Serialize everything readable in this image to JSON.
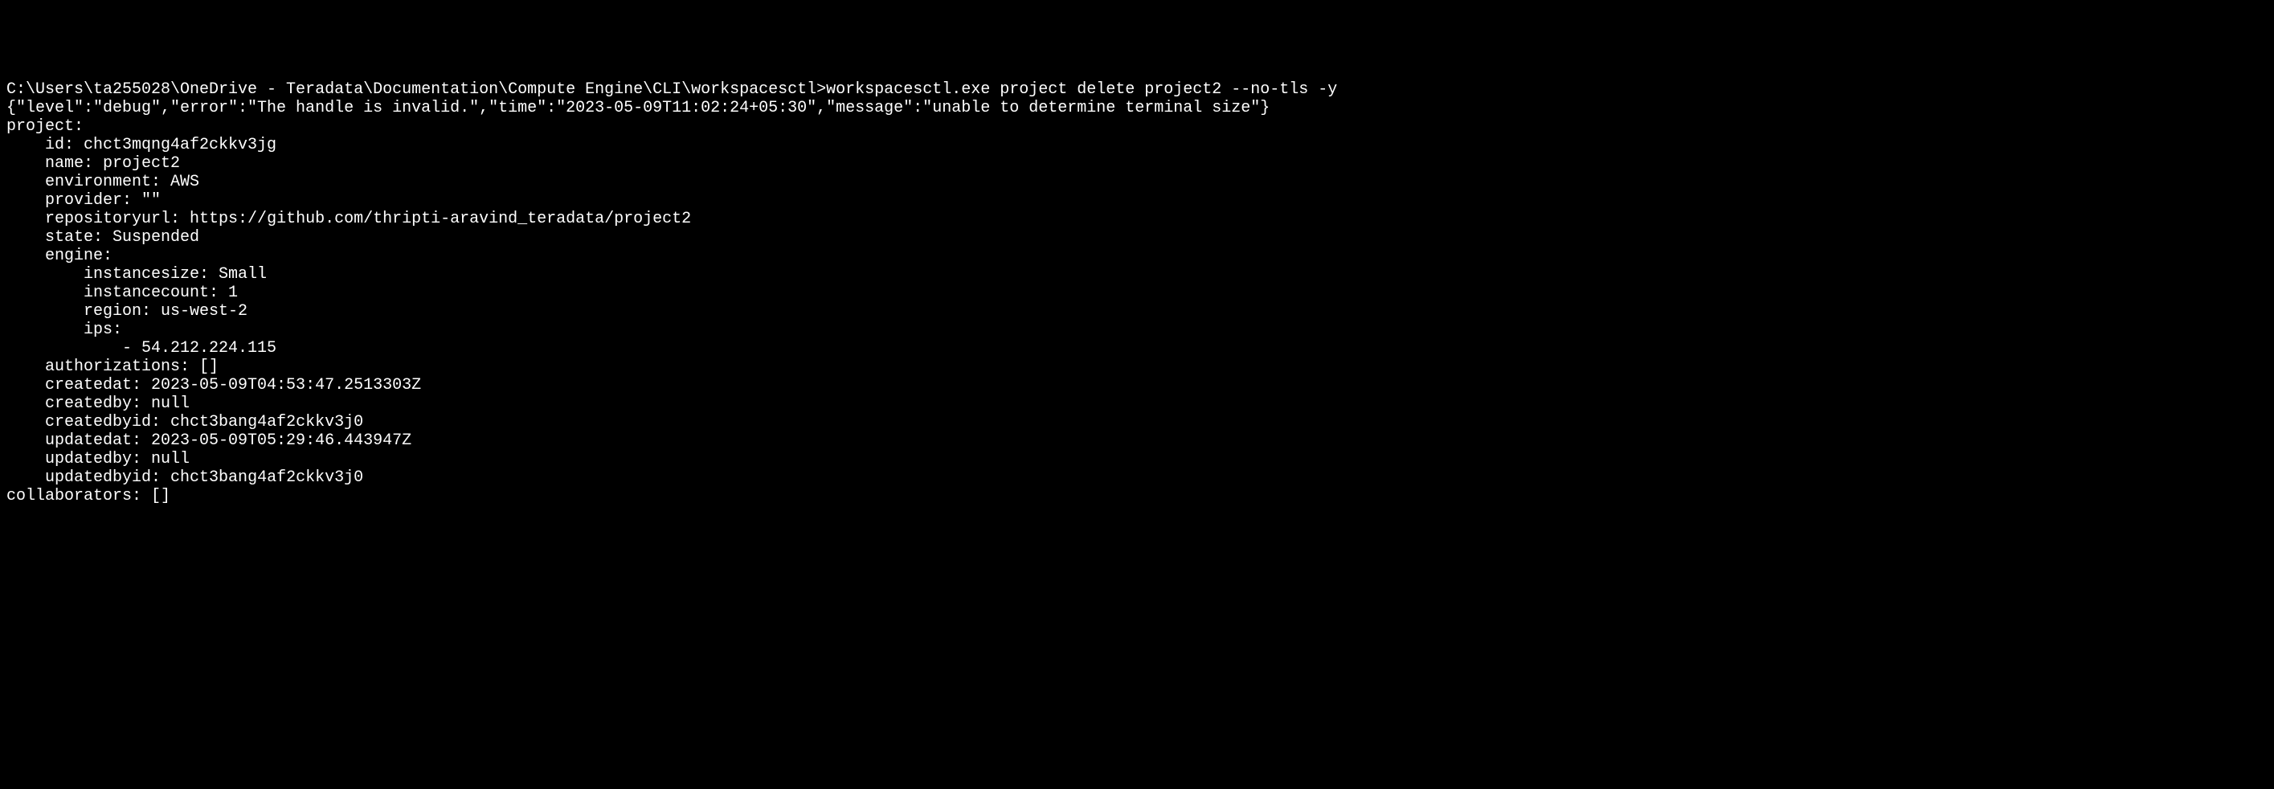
{
  "terminal": {
    "prompt_path": "C:\\Users\\ta255028\\OneDrive - Teradata\\Documentation\\Compute Engine\\CLI\\workspacesctl>",
    "command": "workspacesctl.exe project delete project2 --no-tls -y",
    "debug_line": "{\"level\":\"debug\",\"error\":\"The handle is invalid.\",\"time\":\"2023-05-09T11:02:24+05:30\",\"message\":\"unable to determine terminal size\"}",
    "output": {
      "project_label": "project:",
      "id_label": "    id: ",
      "id_value": "chct3mqng4af2ckkv3jg",
      "name_label": "    name: ",
      "name_value": "project2",
      "environment_label": "    environment: ",
      "environment_value": "AWS",
      "provider_label": "    provider: ",
      "provider_value": "\"\"",
      "repositoryurl_label": "    repositoryurl: ",
      "repositoryurl_value": "https://github.com/thripti-aravind_teradata/project2",
      "state_label": "    state: ",
      "state_value": "Suspended",
      "engine_label": "    engine:",
      "instancesize_label": "        instancesize: ",
      "instancesize_value": "Small",
      "instancecount_label": "        instancecount: ",
      "instancecount_value": "1",
      "region_label": "        region: ",
      "region_value": "us-west-2",
      "ips_label": "        ips:",
      "ips_value": "            - 54.212.224.115",
      "authorizations_label": "    authorizations: ",
      "authorizations_value": "[]",
      "createdat_label": "    createdat: ",
      "createdat_value": "2023-05-09T04:53:47.2513303Z",
      "createdby_label": "    createdby: ",
      "createdby_value": "null",
      "createdbyid_label": "    createdbyid: ",
      "createdbyid_value": "chct3bang4af2ckkv3j0",
      "updatedat_label": "    updatedat: ",
      "updatedat_value": "2023-05-09T05:29:46.443947Z",
      "updatedby_label": "    updatedby: ",
      "updatedby_value": "null",
      "updatedbyid_label": "    updatedbyid: ",
      "updatedbyid_value": "chct3bang4af2ckkv3j0",
      "collaborators_label": "collaborators: ",
      "collaborators_value": "[]"
    }
  }
}
